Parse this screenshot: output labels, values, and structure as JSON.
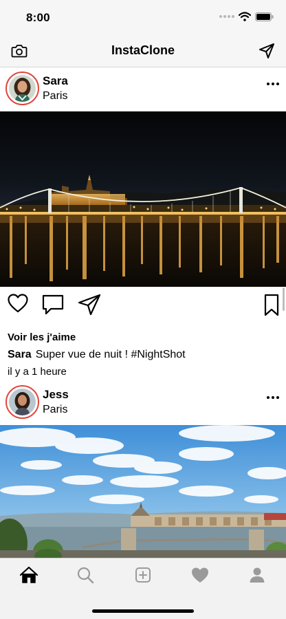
{
  "status_bar": {
    "time": "8:00"
  },
  "nav": {
    "title": "InstaClone",
    "left_icon": "camera-icon",
    "right_icon": "send-icon"
  },
  "posts": [
    {
      "user": "Sara",
      "location": "Paris",
      "likes_link": "Voir les j'aime",
      "caption_user": "Sara",
      "caption_text": "Super vue de nuit ! #NightShot",
      "time_ago": "il y a 1 heure"
    },
    {
      "user": "Jess",
      "location": "Paris"
    }
  ],
  "tabs": [
    "home-icon",
    "search-icon",
    "add-post-icon",
    "heart-icon",
    "profile-icon"
  ],
  "colors": {
    "avatar_ring": "#e0463c",
    "bar_bg": "#f6f6f6",
    "tab_inactive": "#9a9a9a"
  }
}
